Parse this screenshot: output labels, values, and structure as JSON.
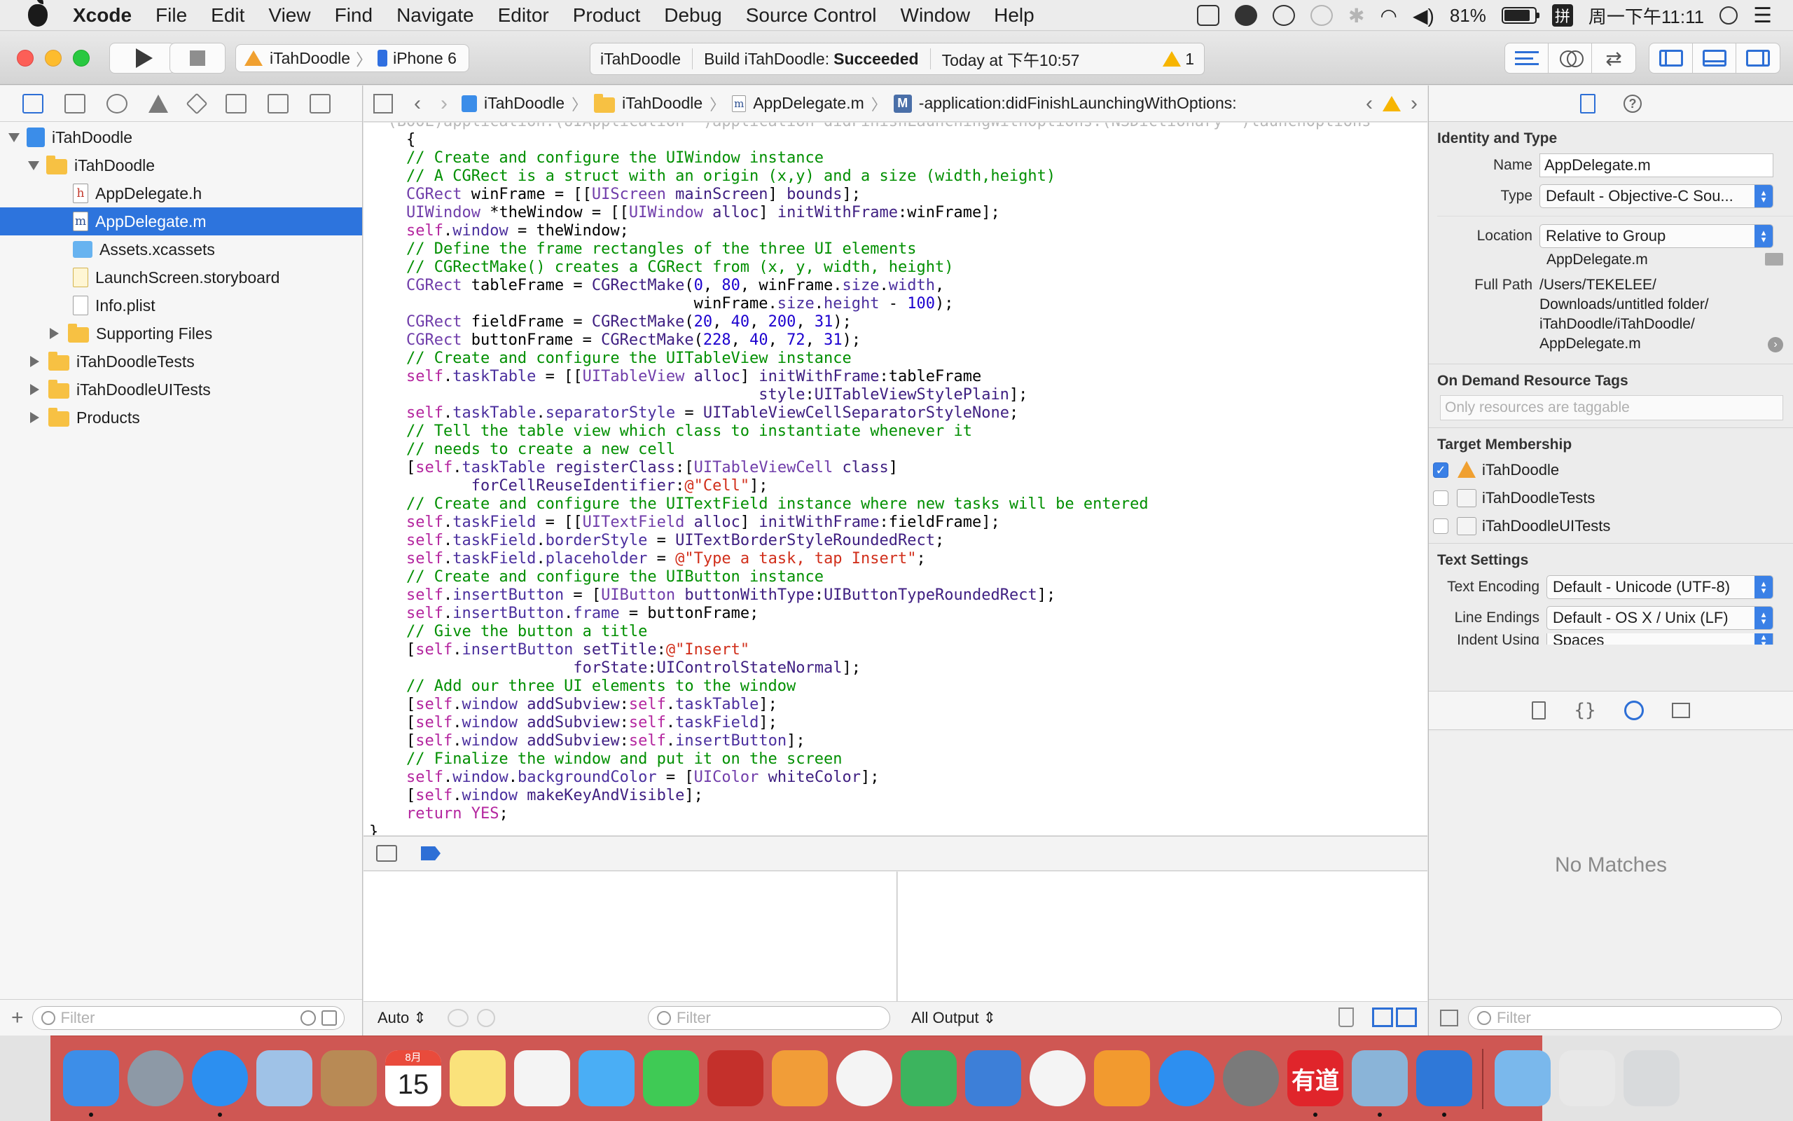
{
  "menubar": {
    "app_name": "Xcode",
    "items": [
      "File",
      "Edit",
      "View",
      "Find",
      "Navigate",
      "Editor",
      "Product",
      "Debug",
      "Source Control",
      "Window",
      "Help"
    ],
    "battery_percent": "81%",
    "input_method": "拼",
    "clock": "周一下午11:11"
  },
  "toolbar": {
    "scheme": "iTahDoodle",
    "destination": "iPhone 6",
    "activity_project": "iTahDoodle",
    "activity_status_prefix": "Build iTahDoodle:",
    "activity_status_result": "Succeeded",
    "activity_time": "Today at 下午10:57",
    "warning_count": "1"
  },
  "navigator": {
    "tree": [
      {
        "label": "iTahDoodle",
        "icon": "project-icon",
        "level": 0,
        "disclosure": "open"
      },
      {
        "label": "iTahDoodle",
        "icon": "folder-icon",
        "level": 1,
        "disclosure": "open"
      },
      {
        "label": "AppDelegate.h",
        "icon": "header-file-icon",
        "level": 2
      },
      {
        "label": "AppDelegate.m",
        "icon": "objc-file-icon",
        "level": 2,
        "selected": true
      },
      {
        "label": "Assets.xcassets",
        "icon": "assets-icon",
        "level": 2
      },
      {
        "label": "LaunchScreen.storyboard",
        "icon": "storyboard-icon",
        "level": 2
      },
      {
        "label": "Info.plist",
        "icon": "plist-icon",
        "level": 2
      },
      {
        "label": "Supporting Files",
        "icon": "folder-icon",
        "level": 2,
        "disclosure": "closed"
      },
      {
        "label": "iTahDoodleTests",
        "icon": "folder-icon",
        "level": 1,
        "disclosure": "closed"
      },
      {
        "label": "iTahDoodleUITests",
        "icon": "folder-icon",
        "level": 1,
        "disclosure": "closed"
      },
      {
        "label": "Products",
        "icon": "folder-icon",
        "level": 1,
        "disclosure": "closed"
      }
    ],
    "filter_placeholder": "Filter"
  },
  "jumpbar": {
    "project": "iTahDoodle",
    "group": "iTahDoodle",
    "file": "AppDelegate.m",
    "method_badge": "M",
    "method": "-application:didFinishLaunchingWithOptions:"
  },
  "editor": {
    "lines": [
      [
        [
          "fd",
          "- (BOOL)application:(UIApplication *)application didFinishLaunchingWithOptions:(NSDictionary *)launchOptions"
        ]
      ],
      [
        [
          "",
          "    {"
        ]
      ],
      [
        [
          "cm",
          "    // Create and configure the UIWindow instance"
        ]
      ],
      [
        [
          "cm",
          "    // A CGRect is a struct with an origin (x,y) and a size (width,height)"
        ]
      ],
      [
        [
          "ty",
          "    CGRect"
        ],
        [
          "",
          " winFrame = [["
        ],
        [
          "ty",
          "UIScreen"
        ],
        [
          "mt",
          " mainScreen"
        ],
        [
          "",
          "] "
        ],
        [
          "mt",
          "bounds"
        ],
        [
          "",
          "];"
        ]
      ],
      [
        [
          "ty",
          "    UIWindow"
        ],
        [
          "",
          " *theWindow = [["
        ],
        [
          "ty",
          "UIWindow"
        ],
        [
          "mt",
          " alloc"
        ],
        [
          "",
          "] "
        ],
        [
          "mt",
          "initWithFrame"
        ],
        [
          "",
          ":winFrame];"
        ]
      ],
      [
        [
          "kw",
          "    self"
        ],
        [
          "",
          "."
        ],
        [
          "pr",
          "window"
        ],
        [
          "",
          " = theWindow;"
        ]
      ],
      [
        [
          "cm",
          "    // Define the frame rectangles of the three UI elements"
        ]
      ],
      [
        [
          "cm",
          "    // CGRectMake() creates a CGRect from (x, y, width, height)"
        ]
      ],
      [
        [
          "ty",
          "    CGRect"
        ],
        [
          "",
          " tableFrame = "
        ],
        [
          "mt",
          "CGRectMake"
        ],
        [
          "",
          "("
        ],
        [
          "nm",
          "0"
        ],
        [
          "",
          ", "
        ],
        [
          "nm",
          "80"
        ],
        [
          "",
          ", winFrame."
        ],
        [
          "pr",
          "size"
        ],
        [
          "",
          "."
        ],
        [
          "pr",
          "width"
        ],
        [
          "",
          ","
        ]
      ],
      [
        [
          "",
          "                                   winFrame."
        ],
        [
          "pr",
          "size"
        ],
        [
          "",
          "."
        ],
        [
          "pr",
          "height"
        ],
        [
          "",
          " - "
        ],
        [
          "nm",
          "100"
        ],
        [
          "",
          ");"
        ]
      ],
      [
        [
          "ty",
          "    CGRect"
        ],
        [
          "",
          " fieldFrame = "
        ],
        [
          "mt",
          "CGRectMake"
        ],
        [
          "",
          "("
        ],
        [
          "nm",
          "20"
        ],
        [
          "",
          ", "
        ],
        [
          "nm",
          "40"
        ],
        [
          "",
          ", "
        ],
        [
          "nm",
          "200"
        ],
        [
          "",
          ", "
        ],
        [
          "nm",
          "31"
        ],
        [
          "",
          ");"
        ]
      ],
      [
        [
          "ty",
          "    CGRect"
        ],
        [
          "",
          " buttonFrame = "
        ],
        [
          "mt",
          "CGRectMake"
        ],
        [
          "",
          "("
        ],
        [
          "nm",
          "228"
        ],
        [
          "",
          ", "
        ],
        [
          "nm",
          "40"
        ],
        [
          "",
          ", "
        ],
        [
          "nm",
          "72"
        ],
        [
          "",
          ", "
        ],
        [
          "nm",
          "31"
        ],
        [
          "",
          ");"
        ]
      ],
      [
        [
          "cm",
          "    // Create and configure the UITableView instance"
        ]
      ],
      [
        [
          "kw",
          "    self"
        ],
        [
          "",
          "."
        ],
        [
          "pr",
          "taskTable"
        ],
        [
          "",
          " = [["
        ],
        [
          "ty",
          "UITableView"
        ],
        [
          "mt",
          " alloc"
        ],
        [
          "",
          "] "
        ],
        [
          "mt",
          "initWithFrame"
        ],
        [
          "",
          ":tableFrame"
        ]
      ],
      [
        [
          "mt",
          "                                          style"
        ],
        [
          "",
          ":"
        ],
        [
          "mt",
          "UITableViewStylePlain"
        ],
        [
          "",
          "];"
        ]
      ],
      [
        [
          "kw",
          "    self"
        ],
        [
          "",
          "."
        ],
        [
          "pr",
          "taskTable"
        ],
        [
          "",
          "."
        ],
        [
          "pr",
          "separatorStyle"
        ],
        [
          "",
          " = "
        ],
        [
          "mt",
          "UITableViewCellSeparatorStyleNone"
        ],
        [
          "",
          ";"
        ]
      ],
      [
        [
          "cm",
          "    // Tell the table view which class to instantiate whenever it"
        ]
      ],
      [
        [
          "cm",
          "    // needs to create a new cell"
        ]
      ],
      [
        [
          "",
          "    ["
        ],
        [
          "kw",
          "self"
        ],
        [
          "",
          "."
        ],
        [
          "pr",
          "taskTable"
        ],
        [
          "mt",
          " registerClass"
        ],
        [
          "",
          ":["
        ],
        [
          "ty",
          "UITableViewCell"
        ],
        [
          "mt",
          " class"
        ],
        [
          "",
          "]"
        ]
      ],
      [
        [
          "mt",
          "           forCellReuseIdentifier"
        ],
        [
          "",
          ":"
        ],
        [
          "st",
          "@\"Cell\""
        ],
        [
          "",
          "];"
        ]
      ],
      [
        [
          "cm",
          "    // Create and configure the UITextField instance where new tasks will be entered"
        ]
      ],
      [
        [
          "kw",
          "    self"
        ],
        [
          "",
          "."
        ],
        [
          "pr",
          "taskField"
        ],
        [
          "",
          " = [["
        ],
        [
          "ty",
          "UITextField"
        ],
        [
          "mt",
          " alloc"
        ],
        [
          "",
          "] "
        ],
        [
          "mt",
          "initWithFrame"
        ],
        [
          "",
          ":fieldFrame];"
        ]
      ],
      [
        [
          "kw",
          "    self"
        ],
        [
          "",
          "."
        ],
        [
          "pr",
          "taskField"
        ],
        [
          "",
          "."
        ],
        [
          "pr",
          "borderStyle"
        ],
        [
          "",
          " = "
        ],
        [
          "mt",
          "UITextBorderStyleRoundedRect"
        ],
        [
          "",
          ";"
        ]
      ],
      [
        [
          "kw",
          "    self"
        ],
        [
          "",
          "."
        ],
        [
          "pr",
          "taskField"
        ],
        [
          "",
          "."
        ],
        [
          "pr",
          "placeholder"
        ],
        [
          "",
          " = "
        ],
        [
          "st",
          "@\"Type a task, tap Insert\""
        ],
        [
          "",
          ";"
        ]
      ],
      [
        [
          "cm",
          "    // Create and configure the UIButton instance"
        ]
      ],
      [
        [
          "kw",
          "    self"
        ],
        [
          "",
          "."
        ],
        [
          "pr",
          "insertButton"
        ],
        [
          "",
          " = ["
        ],
        [
          "ty",
          "UIButton"
        ],
        [
          "mt",
          " buttonWithType"
        ],
        [
          "",
          ":"
        ],
        [
          "mt",
          "UIButtonTypeRoundedRect"
        ],
        [
          "",
          "];"
        ]
      ],
      [
        [
          "kw",
          "    self"
        ],
        [
          "",
          "."
        ],
        [
          "pr",
          "insertButton"
        ],
        [
          "",
          "."
        ],
        [
          "pr",
          "frame"
        ],
        [
          "",
          " = buttonFrame;"
        ]
      ],
      [
        [
          "cm",
          "    // Give the button a title"
        ]
      ],
      [
        [
          "",
          "    ["
        ],
        [
          "kw",
          "self"
        ],
        [
          "",
          "."
        ],
        [
          "pr",
          "insertButton"
        ],
        [
          "mt",
          " setTitle"
        ],
        [
          "",
          ":"
        ],
        [
          "st",
          "@\"Insert\""
        ]
      ],
      [
        [
          "mt",
          "                      forState"
        ],
        [
          "",
          ":"
        ],
        [
          "mt",
          "UIControlStateNormal"
        ],
        [
          "",
          "];"
        ]
      ],
      [
        [
          "cm",
          "    // Add our three UI elements to the window"
        ]
      ],
      [
        [
          "",
          "    ["
        ],
        [
          "kw",
          "self"
        ],
        [
          "",
          "."
        ],
        [
          "pr",
          "window"
        ],
        [
          "mt",
          " addSubview"
        ],
        [
          "",
          ":"
        ],
        [
          "kw",
          "self"
        ],
        [
          "",
          "."
        ],
        [
          "pr",
          "taskTable"
        ],
        [
          "",
          "];"
        ]
      ],
      [
        [
          "",
          "    ["
        ],
        [
          "kw",
          "self"
        ],
        [
          "",
          "."
        ],
        [
          "pr",
          "window"
        ],
        [
          "mt",
          " addSubview"
        ],
        [
          "",
          ":"
        ],
        [
          "kw",
          "self"
        ],
        [
          "",
          "."
        ],
        [
          "pr",
          "taskField"
        ],
        [
          "",
          "];"
        ]
      ],
      [
        [
          "",
          "    ["
        ],
        [
          "kw",
          "self"
        ],
        [
          "",
          "."
        ],
        [
          "pr",
          "window"
        ],
        [
          "mt",
          " addSubview"
        ],
        [
          "",
          ":"
        ],
        [
          "kw",
          "self"
        ],
        [
          "",
          "."
        ],
        [
          "pr",
          "insertButton"
        ],
        [
          "",
          "];"
        ]
      ],
      [
        [
          "cm",
          "    // Finalize the window and put it on the screen"
        ]
      ],
      [
        [
          "kw",
          "    self"
        ],
        [
          "",
          "."
        ],
        [
          "pr",
          "window"
        ],
        [
          "",
          "."
        ],
        [
          "pr",
          "backgroundColor"
        ],
        [
          "",
          " = ["
        ],
        [
          "ty",
          "UIColor"
        ],
        [
          "mt",
          " whiteColor"
        ],
        [
          "",
          "];"
        ]
      ],
      [
        [
          "",
          "    ["
        ],
        [
          "kw",
          "self"
        ],
        [
          "",
          "."
        ],
        [
          "pr",
          "window"
        ],
        [
          "mt",
          " makeKeyAndVisible"
        ],
        [
          "",
          "];"
        ]
      ],
      [
        [
          "kw",
          "    return"
        ],
        [
          "",
          " "
        ],
        [
          "kw",
          "YES"
        ],
        [
          "",
          ";"
        ]
      ],
      [
        [
          "",
          "}"
        ]
      ]
    ]
  },
  "debug": {
    "scope_popup": "Auto",
    "vars_filter_placeholder": "Filter",
    "console_output_popup": "All Output"
  },
  "inspector": {
    "identity_title": "Identity and Type",
    "name_label": "Name",
    "name_value": "AppDelegate.m",
    "type_label": "Type",
    "type_value": "Default - Objective-C Sou...",
    "location_label": "Location",
    "location_value": "Relative to Group",
    "location_file": "AppDelegate.m",
    "full_path_label": "Full Path",
    "full_path_lines": [
      "/Users/TEKELEE/",
      "Downloads/untitled folder/",
      "iTahDoodle/iTahDoodle/",
      "AppDelegate.m"
    ],
    "odr_title": "On Demand Resource Tags",
    "odr_placeholder": "Only resources are taggable",
    "target_title": "Target Membership",
    "targets": [
      {
        "label": "iTahDoodle",
        "checked": true,
        "icon": "app-target-icon"
      },
      {
        "label": "iTahDoodleTests",
        "checked": false,
        "icon": "test-bundle-icon"
      },
      {
        "label": "iTahDoodleUITests",
        "checked": false,
        "icon": "test-bundle-icon"
      }
    ],
    "text_settings_title": "Text Settings",
    "encoding_label": "Text Encoding",
    "encoding_value": "Default - Unicode (UTF-8)",
    "line_endings_label": "Line Endings",
    "line_endings_value": "Default - OS X / Unix (LF)",
    "indent_label": "Indent Using",
    "indent_value": "Spaces",
    "library_empty": "No Matches",
    "library_filter_placeholder": "Filter"
  },
  "dock": {
    "calendar_month": "8月",
    "calendar_day": "15",
    "youdao_label": "有道",
    "icons": [
      {
        "name": "finder-icon",
        "color": "#3d8ee8",
        "running": true
      },
      {
        "name": "launchpad-icon",
        "color": "#8d99a6",
        "running": false
      },
      {
        "name": "safari-icon",
        "color": "#2c8ff0",
        "running": true
      },
      {
        "name": "mail-icon",
        "color": "#9fc2e7",
        "running": false
      },
      {
        "name": "contacts-icon",
        "color": "#b88a55",
        "running": false
      },
      {
        "name": "calendar-icon",
        "color": "#ffffff",
        "running": false
      },
      {
        "name": "notes-icon",
        "color": "#fae27b",
        "running": false
      },
      {
        "name": "reminders-icon",
        "color": "#f4f4f4",
        "running": false
      },
      {
        "name": "messages-icon",
        "color": "#4aaef5",
        "running": false
      },
      {
        "name": "facetime-icon",
        "color": "#3fca55",
        "running": false
      },
      {
        "name": "photo-booth-icon",
        "color": "#c4302b",
        "running": false
      },
      {
        "name": "pages-icon",
        "color": "#f19d38",
        "running": false
      },
      {
        "name": "photos-icon",
        "color": "#f4f4f4",
        "running": false
      },
      {
        "name": "numbers-icon",
        "color": "#3cb45e",
        "running": false
      },
      {
        "name": "keynote-icon",
        "color": "#3d7fd8",
        "running": false
      },
      {
        "name": "itunes-icon",
        "color": "#f4f4f4",
        "running": false
      },
      {
        "name": "ibooks-icon",
        "color": "#f29a2f",
        "running": false
      },
      {
        "name": "app-store-icon",
        "color": "#2d8ff0",
        "running": false
      },
      {
        "name": "system-preferences-icon",
        "color": "#7a7a7a",
        "running": false
      },
      {
        "name": "youdao-dict-icon",
        "color": "#e0252b",
        "running": true
      },
      {
        "name": "preview-icon",
        "color": "#8ab4d8",
        "running": true
      },
      {
        "name": "xcode-icon",
        "color": "#2f78d8",
        "running": true
      },
      {
        "name": "downloads-folder-icon",
        "color": "#7ab8ec",
        "running": false
      },
      {
        "name": "documents-stack-icon",
        "color": "#e8e8e8",
        "running": false
      },
      {
        "name": "trash-icon",
        "color": "#d8dadc",
        "running": false
      }
    ]
  }
}
